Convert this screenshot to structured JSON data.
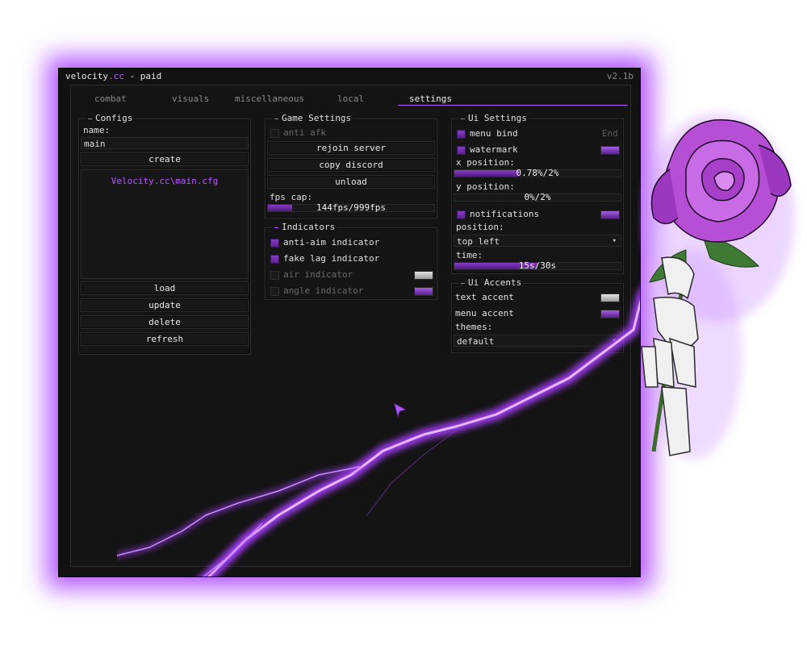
{
  "window": {
    "title_prefix": "velocity",
    "title_accent": ".cc",
    "title_suffix": " - paid",
    "version": "v2.1b"
  },
  "tabs": [
    {
      "label": "combat",
      "active": false
    },
    {
      "label": "visuals",
      "active": false
    },
    {
      "label": "miscellaneous",
      "active": false
    },
    {
      "label": "local",
      "active": false
    },
    {
      "label": "settings",
      "active": true
    }
  ],
  "configs": {
    "title": "Configs",
    "name_label": "name:",
    "name_value": "main",
    "create": "create",
    "selected_file": "Velocity.cc\\main.cfg",
    "load": "load",
    "update": "update",
    "delete": "delete",
    "refresh": "refresh"
  },
  "game_settings": {
    "title": "Game Settings",
    "anti_afk": "anti afk",
    "anti_afk_checked": false,
    "rejoin": "rejoin server",
    "copy_discord": "copy discord",
    "unload": "unload",
    "fps_label": "fps cap:",
    "fps_value": "144fps/999fps",
    "fps_fraction": 0.144
  },
  "indicators": {
    "title": "Indicators",
    "items": [
      {
        "label": "anti-aim indicator",
        "checked": true
      },
      {
        "label": "fake lag indicator",
        "checked": true
      },
      {
        "label": "air indicator",
        "checked": false
      },
      {
        "label": "angle indicator",
        "checked": false
      }
    ]
  },
  "ui_settings": {
    "title": "Ui Settings",
    "menu_bind": "menu bind",
    "menu_bind_key": "End",
    "watermark": "watermark",
    "x_label": "x position:",
    "x_value": "0.78%/2%",
    "x_fraction": 0.39,
    "y_label": "y position:",
    "y_value": "0%/2%",
    "y_fraction": 0.0,
    "notifications": "notifications",
    "position_label": "position:",
    "position_value": "top left",
    "time_label": "time:",
    "time_value": "15s/30s",
    "time_fraction": 0.5
  },
  "ui_accents": {
    "title": "Ui Accents",
    "text_accent": "text accent",
    "menu_accent": "menu accent",
    "themes_label": "themes:",
    "theme_value": "default"
  },
  "colors": {
    "accent": "#b65cff",
    "glow": "#a83cff",
    "swatch_white": "#d8d8d8",
    "swatch_purple": "#8f46d1"
  }
}
